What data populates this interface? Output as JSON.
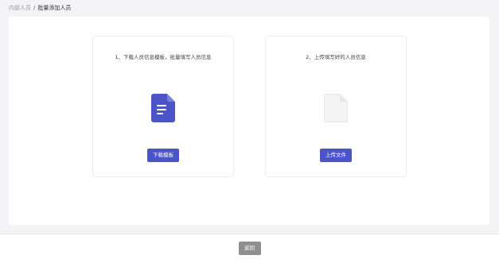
{
  "breadcrumb": {
    "parent": "内部人员",
    "separator": "/",
    "current": "批量添加人员"
  },
  "steps": [
    {
      "title": "1、下载人员信息模板，批量填写人员信息",
      "icon": "document-icon",
      "icon_color": "#4c55c8",
      "button_label": "下载模板"
    },
    {
      "title": "2、上传填写好的人员信息",
      "icon": "blank-file-icon",
      "icon_color": "#f2f2f2",
      "button_label": "上传文件"
    }
  ],
  "footer": {
    "back_label": "返回"
  },
  "colors": {
    "accent": "#4c55c8",
    "back_button": "#8f8f8f",
    "background": "#f4f4f6"
  }
}
